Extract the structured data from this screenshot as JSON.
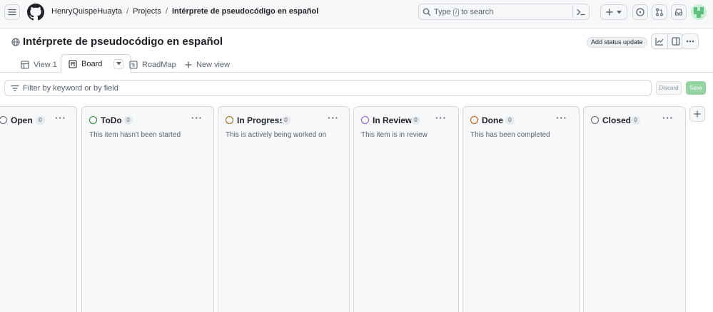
{
  "header": {
    "breadcrumb": {
      "owner": "HenryQuispeHuayta",
      "sep1": "/",
      "projects": "Projects",
      "sep2": "/",
      "project": "Intérprete de pseudocódigo en español"
    },
    "search": {
      "prefix": "Type",
      "key": "/",
      "suffix": "to search"
    }
  },
  "project": {
    "title": "Intérprete de pseudocódigo en español",
    "status_button": "Add status update"
  },
  "views": {
    "tabs": [
      {
        "label": "View 1",
        "icon": "table-icon"
      },
      {
        "label": "Board",
        "icon": "board-icon",
        "active": true
      },
      {
        "label": "RoadMap",
        "icon": "roadmap-icon"
      }
    ],
    "new_view": "New view"
  },
  "filter": {
    "placeholder": "Filter by keyword or by field",
    "discard": "Discard",
    "save": "Save",
    "save_color": "#94d3a2"
  },
  "board": {
    "columns": [
      {
        "name": "Open",
        "count": "0",
        "description": "",
        "color": "#59636e"
      },
      {
        "name": "ToDo",
        "count": "0",
        "description": "This item hasn't been started",
        "color": "#1a7f37"
      },
      {
        "name": "In Progress",
        "count": "0",
        "description": "This is actively being worked on",
        "color": "#9a6700"
      },
      {
        "name": "In Review",
        "count": "0",
        "description": "This item is in review",
        "color": "#8250df"
      },
      {
        "name": "Done",
        "count": "0",
        "description": "This has been completed",
        "color": "#bc4c00"
      },
      {
        "name": "Closed",
        "count": "0",
        "description": "",
        "color": "#59636e"
      }
    ]
  }
}
